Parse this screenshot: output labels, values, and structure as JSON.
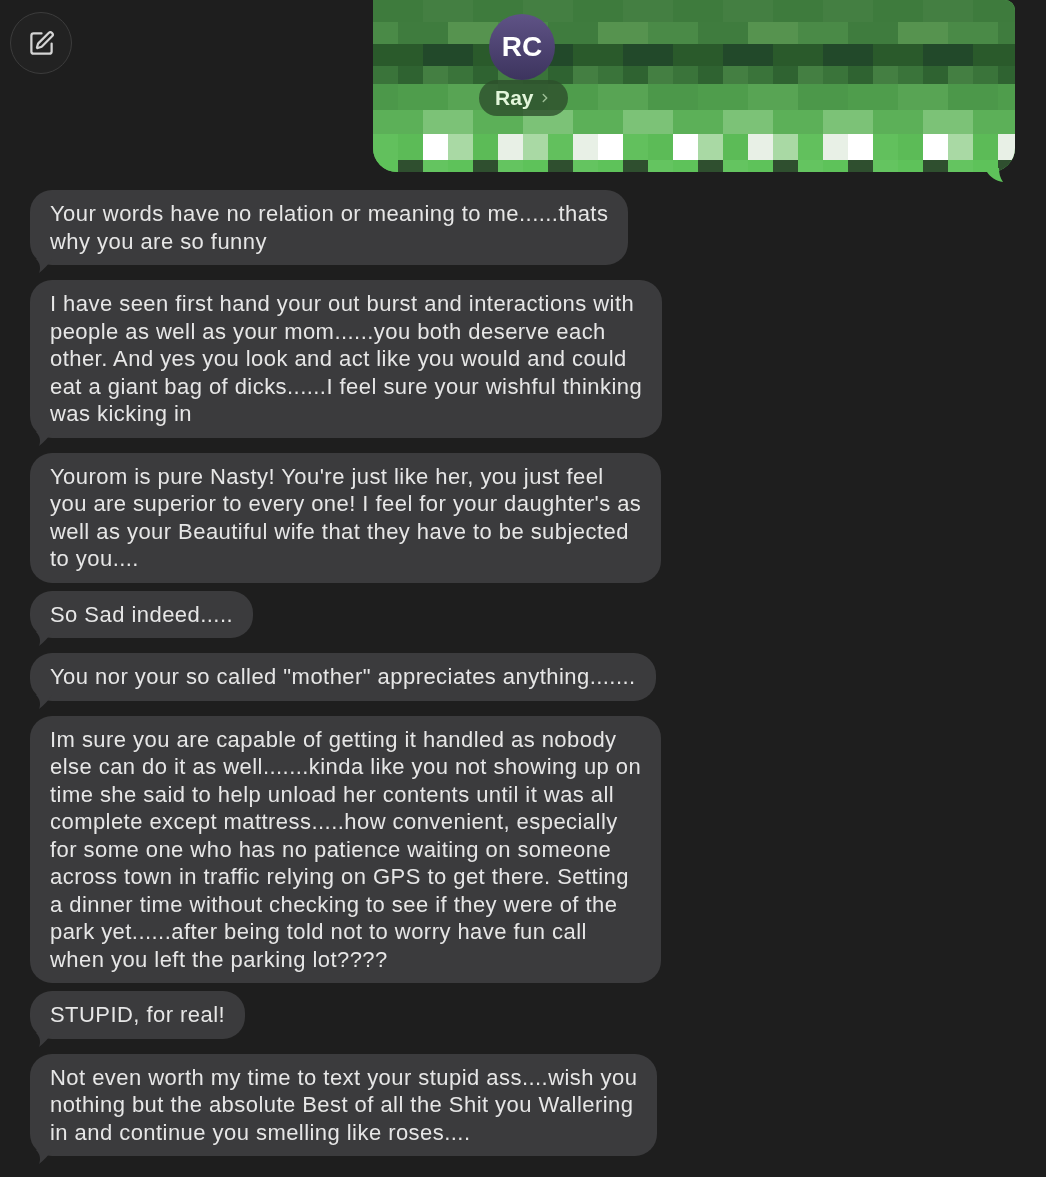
{
  "contact": {
    "initials": "RC",
    "name": "Ray"
  },
  "messages": [
    {
      "lines": [
        "Your words have no relation or meaning to me......thats",
        "why you are so funny"
      ],
      "tail": true
    },
    {
      "lines": [
        "I have seen first hand your out burst and interactions with",
        "people as well as your mom......you both deserve each",
        "other. And yes you look and act like you would and could",
        "eat a giant bag of dicks......I feel sure your wishful thinking",
        "was kicking in"
      ],
      "tail": true
    },
    {
      "lines": [
        "Yourom is pure Nasty! You're just like her, you just feel",
        "you are superior to every one! I feel for your daughter's as",
        "well as your Beautiful wife that they have to be subjected",
        "to you...."
      ],
      "tail": false
    },
    {
      "lines": [
        "So Sad indeed....."
      ],
      "tail": true
    },
    {
      "lines": [
        "You nor your so called \"mother\" appreciates anything......."
      ],
      "tail": true
    },
    {
      "lines": [
        "Im sure you are capable of getting it handled as nobody",
        "else can do it as well.......kinda like you not showing up on",
        "time she said to help unload her contents until it was all",
        "complete except mattress.....how convenient, especially",
        "for some one who has no patience waiting on someone",
        "across town in traffic relying on GPS to get there. Setting",
        "a dinner time without checking to see if they were of the",
        "park yet......after being told not to worry have fun call",
        "when you left the parking lot????"
      ],
      "tail": false
    },
    {
      "lines": [
        "STUPID, for real!"
      ],
      "tail": true
    },
    {
      "lines": [
        "Not even worth my time to text your stupid ass....wish you",
        "nothing but the absolute Best of all the Shit you Wallering",
        "in and continue you smelling like roses...."
      ],
      "tail": true
    }
  ]
}
